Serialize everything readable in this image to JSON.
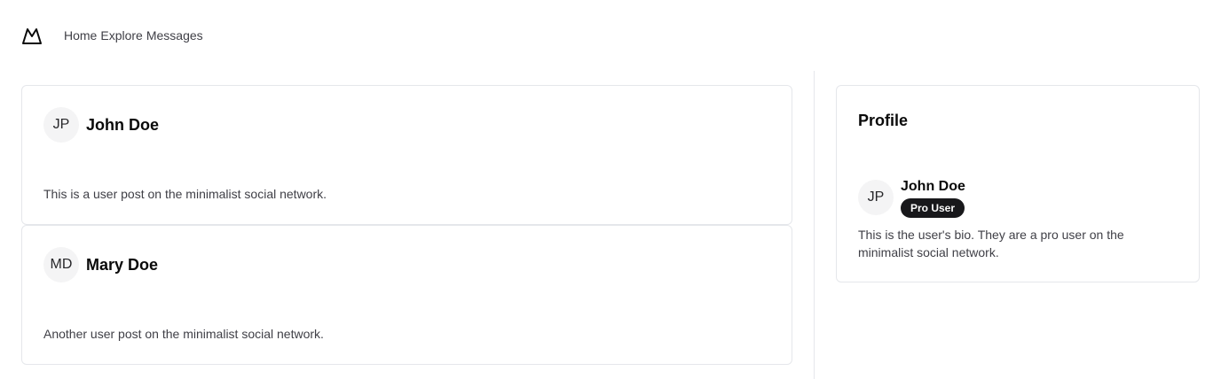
{
  "header": {
    "logo_icon": "mountain-logo-icon",
    "nav": [
      {
        "label": "Home"
      },
      {
        "label": "Explore"
      },
      {
        "label": "Messages"
      }
    ]
  },
  "feed": {
    "posts": [
      {
        "initials": "JP",
        "author": "John Doe",
        "body": "This is a user post on the minimalist social network."
      },
      {
        "initials": "MD",
        "author": "Mary Doe",
        "body": "Another user post on the minimalist social network."
      }
    ]
  },
  "profile": {
    "title": "Profile",
    "initials": "JP",
    "name": "John Doe",
    "badge": "Pro User",
    "bio": "This is the user's bio. They are a pro user on the minimalist social network."
  },
  "colors": {
    "border": "#e5e7eb",
    "muted_text": "#3f3f46",
    "badge_bg": "#18181b",
    "avatar_bg": "#f4f4f5"
  }
}
